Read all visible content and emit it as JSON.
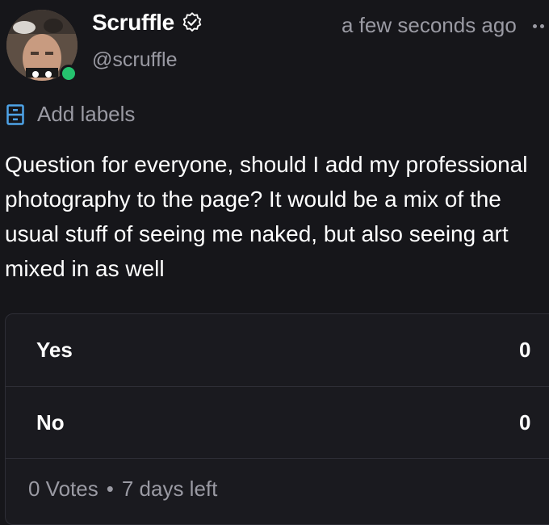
{
  "author": {
    "display_name": "Scruffle",
    "handle": "@scruffle",
    "avatar_icon": "user-photo-avatar",
    "verified_icon": "verified-badge-icon",
    "online": true
  },
  "post": {
    "timestamp": "a few seconds ago",
    "text": "Question for everyone, should I add my professional photography to the page? It would be a mix of the usual stuff of seeing me naked, but also seeing art mixed in as well"
  },
  "labels": {
    "label": "Add labels",
    "icon": "label-drawer-icon"
  },
  "poll": {
    "options": [
      {
        "label": "Yes",
        "count": "0"
      },
      {
        "label": "No",
        "count": "0"
      }
    ],
    "votes": "0 Votes",
    "separator": "•",
    "time_left": "7 days left"
  },
  "colors": {
    "background": "#16161a",
    "muted_text": "#9a9aa3",
    "accent_blue": "#4ea3e8",
    "online_green": "#25c26e",
    "border": "#2e2e36"
  }
}
